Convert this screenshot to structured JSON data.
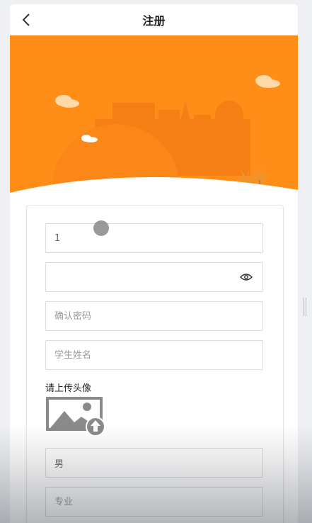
{
  "navbar": {
    "title": "注册"
  },
  "form": {
    "account_value": "1",
    "password_value": "",
    "confirm_password_placeholder": "确认密码",
    "student_name_placeholder": "学生姓名",
    "avatar_label": "请上传头像",
    "gender_value": "男",
    "major_placeholder": "专业"
  },
  "colors": {
    "banner_orange": "#ff8e19",
    "building_orange": "#f47f17",
    "border": "#dcdcdc"
  },
  "icons": {
    "back": "chevron-left-icon",
    "eye": "eye-icon",
    "upload": "image-upload-icon"
  }
}
